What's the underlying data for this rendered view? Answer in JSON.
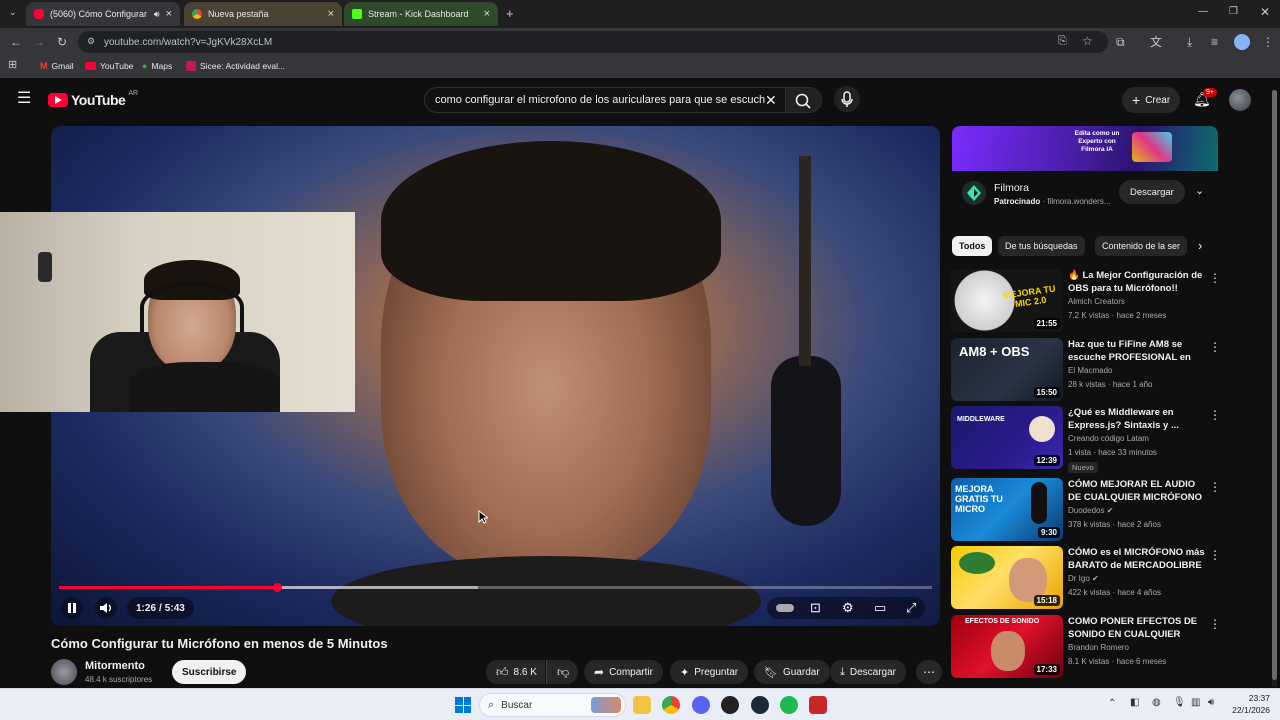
{
  "browser": {
    "tabs": [
      {
        "title": "(5060) Cómo Configurar tu",
        "active": true,
        "favicon": "youtube-icon"
      },
      {
        "title": "Nueva pestaña",
        "active": false,
        "favicon": "chrome-icon"
      },
      {
        "title": "Stream - Kick Dashboard",
        "active": false,
        "favicon": "kick-icon"
      }
    ],
    "url": "youtube.com/watch?v=JgKVk28XcLM",
    "bookmarks": [
      {
        "label": "Gmail"
      },
      {
        "label": "YouTube"
      },
      {
        "label": "Maps"
      },
      {
        "label": "Sicee: Actividad eval..."
      }
    ]
  },
  "youtube": {
    "logo_text": "YouTube",
    "region": "AR",
    "search_query": "como configurar el microfono de los auriculares para que se escuche",
    "create_label": "Crear",
    "notifications_badge": "9+"
  },
  "player": {
    "current_time": "1:26",
    "separator": "/",
    "duration": "5:43",
    "progress_fraction": 0.25,
    "buffered_fraction": 0.48
  },
  "video": {
    "title": "Cómo Configurar tu Micrófono en menos de 5 Minutos",
    "channel": "Mitormento",
    "subscribers": "48.4 k suscriptores",
    "subscribe_label": "Suscribirse",
    "likes": "8.6 K",
    "share_label": "Compartir",
    "ask_label": "Preguntar",
    "save_label": "Guardar",
    "download_label": "Descargar"
  },
  "ad": {
    "banner_line1": "Edita como un",
    "banner_line2": "Experto con",
    "banner_line3": "Filmora IA",
    "name": "Filmora",
    "sponsored": "Patrocinado",
    "domain": "· filmora.wonders...",
    "cta": "Descargar"
  },
  "filters": [
    "Todos",
    "De tus búsquedas",
    "Contenido de la ser"
  ],
  "recommendations": [
    {
      "title": "🔥 La Mejor Configuración de OBS para tu Micrófono!!",
      "channel": "Almich Creators",
      "verified": false,
      "meta": "7.2 K vistas · hace 2 meses",
      "duration": "21:55",
      "badge": "",
      "thumb_text": "MEJORA TU MIC 2.0"
    },
    {
      "title": "Haz que tu FiFine AM8 se escuche PROFESIONAL en OB...",
      "channel": "El Macmado",
      "verified": false,
      "meta": "28 k vistas · hace 1 año",
      "duration": "15:50",
      "badge": "",
      "thumb_text": "AM8 + OBS"
    },
    {
      "title": "¿Qué es Middleware en Express.js? Sintaxis y ...",
      "channel": "Creando código Latam",
      "verified": false,
      "meta": "1 vista · hace 33 minutos",
      "duration": "12:39",
      "badge": "Nuevo",
      "thumb_text": "MIDDLEWARE"
    },
    {
      "title": "CÓMO MEJORAR EL AUDIO DE CUALQUIER MICRÓFONO EN ...",
      "channel": "Duodedos",
      "verified": true,
      "meta": "378 k vistas · hace 2 años",
      "duration": "9:30",
      "badge": "",
      "thumb_text": "MEJORA GRATIS TU MICRO"
    },
    {
      "title": "CÓMO es el MICRÓFONO más BARATO de MERCADOLIBRE ...",
      "channel": "Dr Igo",
      "verified": true,
      "meta": "422 k vistas · hace 4 años",
      "duration": "15:18",
      "badge": "",
      "thumb_text": ""
    },
    {
      "title": "COMO PONER EFECTOS DE SONIDO EN CUALQUIER CHAT...",
      "channel": "Brandon Romero",
      "verified": false,
      "meta": "8.1 K vistas · hace 6 meses",
      "duration": "17:33",
      "badge": "",
      "thumb_text": "EFECTOS DE SONIDO"
    }
  ],
  "taskbar": {
    "search_placeholder": "Buscar",
    "time": "23:37",
    "date": "22/1/2026"
  }
}
